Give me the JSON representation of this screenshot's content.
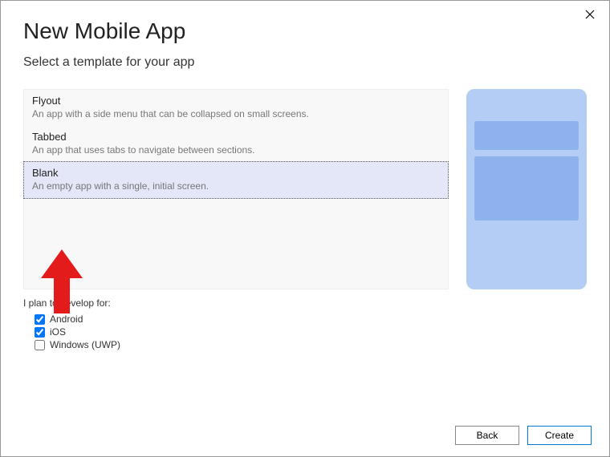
{
  "dialog": {
    "title": "New Mobile App",
    "subtitle": "Select a template for your app"
  },
  "templates": [
    {
      "name": "Flyout",
      "desc": "An app with a side menu that can be collapsed on small screens."
    },
    {
      "name": "Tabbed",
      "desc": "An app that uses tabs to navigate between sections."
    },
    {
      "name": "Blank",
      "desc": "An empty app with a single, initial screen."
    }
  ],
  "selected_template_index": 2,
  "develop": {
    "label": "I plan to develop for:",
    "options": [
      {
        "label": "Android",
        "checked": true
      },
      {
        "label": "iOS",
        "checked": true
      },
      {
        "label": "Windows (UWP)",
        "checked": false
      }
    ]
  },
  "buttons": {
    "back": "Back",
    "create": "Create"
  },
  "annotation": {
    "arrow_color": "#e31b1b"
  }
}
